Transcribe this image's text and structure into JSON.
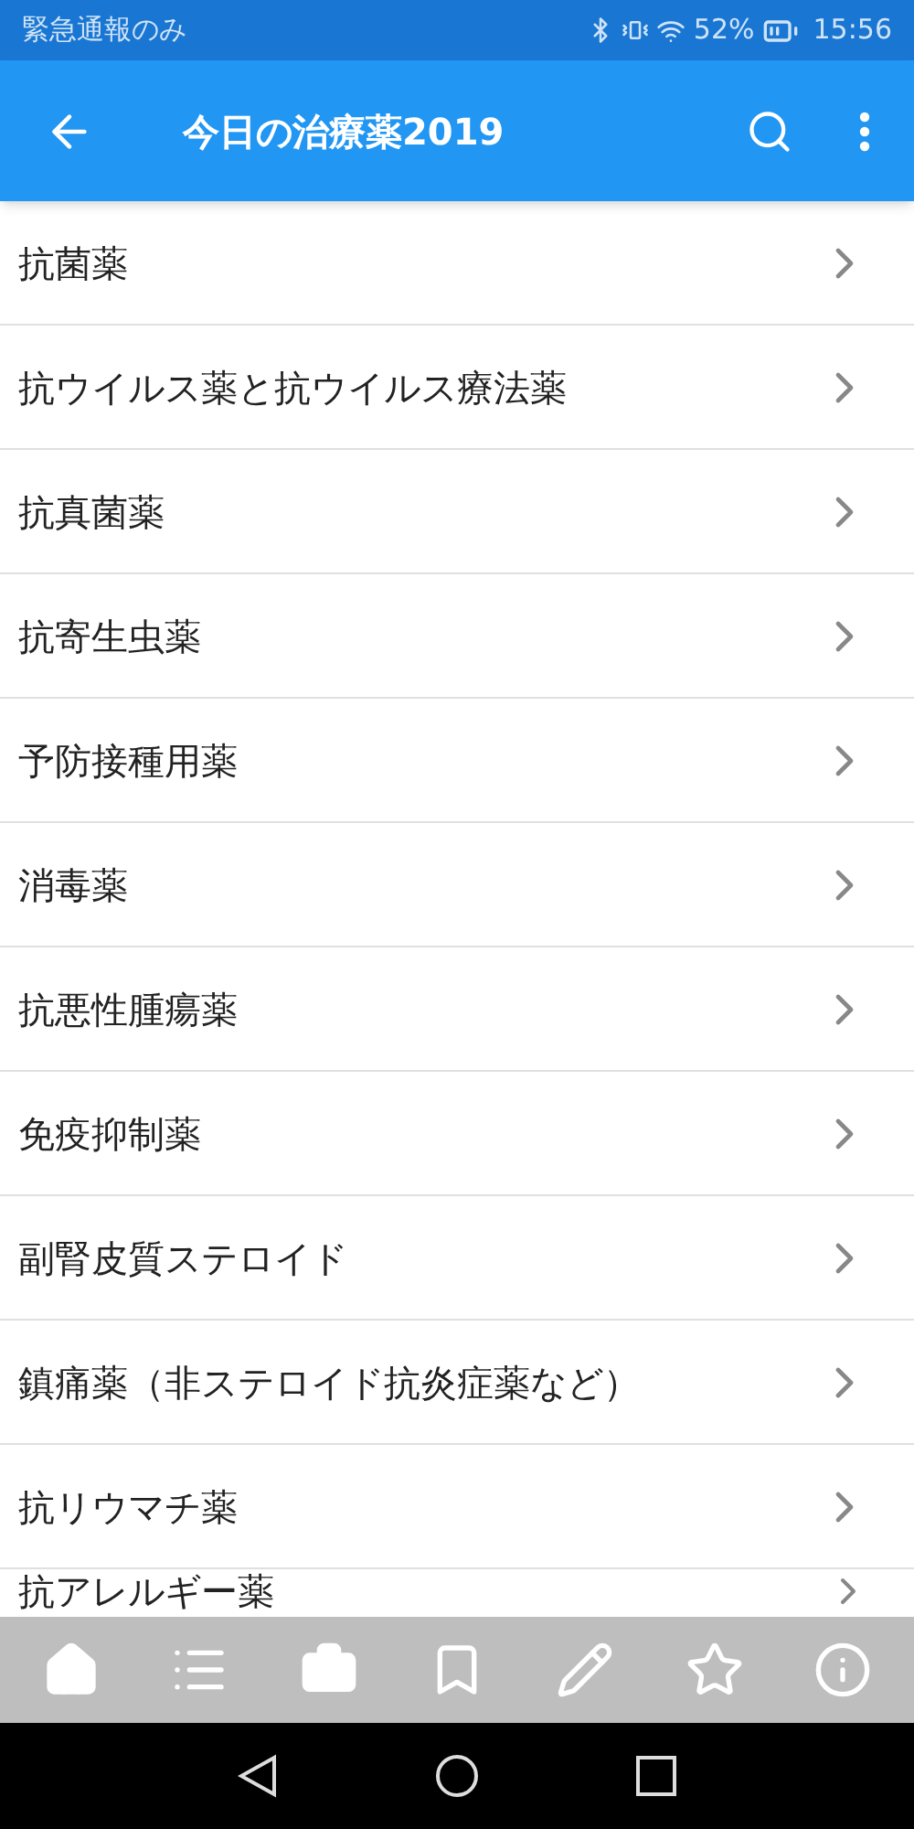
{
  "status_bar": {
    "carrier": "緊急通報のみ",
    "battery": "52%",
    "time": "15:56"
  },
  "app_bar": {
    "title": "今日の治療薬2019"
  },
  "list": [
    {
      "label": "抗菌薬"
    },
    {
      "label": "抗ウイルス薬と抗ウイルス療法薬"
    },
    {
      "label": "抗真菌薬"
    },
    {
      "label": "抗寄生虫薬"
    },
    {
      "label": "予防接種用薬"
    },
    {
      "label": "消毒薬"
    },
    {
      "label": "抗悪性腫瘍薬"
    },
    {
      "label": "免疫抑制薬"
    },
    {
      "label": "副腎皮質ステロイド"
    },
    {
      "label": "鎮痛薬（非ステロイド抗炎症薬など）"
    },
    {
      "label": "抗リウマチ薬"
    },
    {
      "label": "抗アレルギー薬"
    }
  ],
  "bottom_nav": [
    {
      "kind": "home"
    },
    {
      "kind": "list"
    },
    {
      "kind": "briefcase"
    },
    {
      "kind": "bookmark"
    },
    {
      "kind": "pencil"
    },
    {
      "kind": "star"
    },
    {
      "kind": "info"
    }
  ]
}
